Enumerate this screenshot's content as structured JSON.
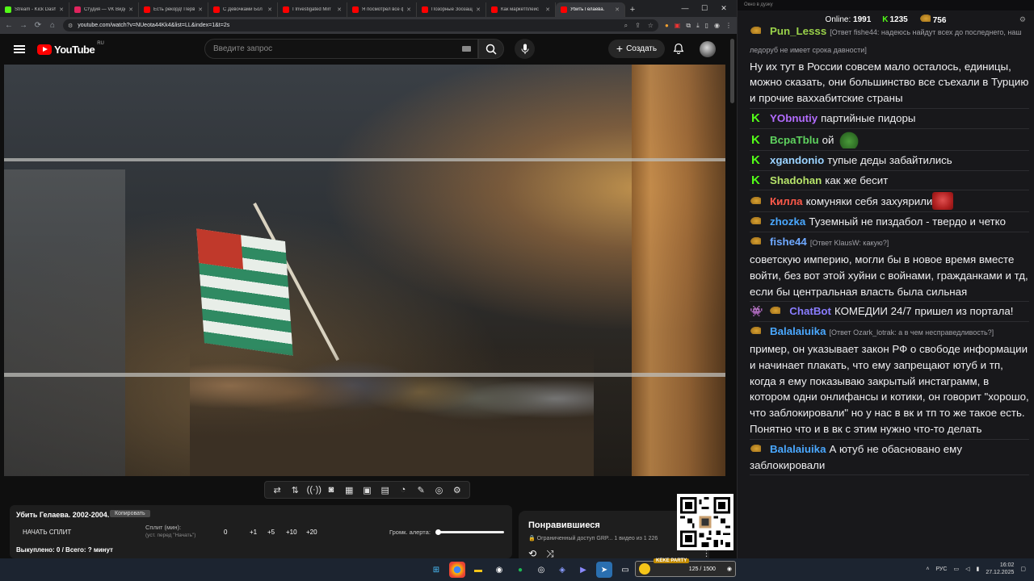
{
  "browser": {
    "tabs": [
      {
        "title": "Stream - Kick Dash",
        "color": "#53fc18",
        "active": false
      },
      {
        "title": "Студия — VK Видео",
        "color": "#e0245e",
        "active": false
      },
      {
        "title": "Есть рекорд! Перв",
        "color": "#ff0000",
        "active": false
      },
      {
        "title": "С Девочками Бол",
        "color": "#ff0000",
        "active": false
      },
      {
        "title": "I Investigated Mirr",
        "color": "#ff0000",
        "active": false
      },
      {
        "title": "Я посмотрел все ф",
        "color": "#ff0000",
        "active": false
      },
      {
        "title": "Позорные Зоозащ",
        "color": "#ff0000",
        "active": false
      },
      {
        "title": "Как маркетплейс",
        "color": "#ff0000",
        "active": false
      },
      {
        "title": "Убить Гелаева.",
        "color": "#ff0000",
        "active": true
      }
    ],
    "url": "youtube.com/watch?v=NUeota44Kk4&list=LL&index=1&t=2s"
  },
  "youtube": {
    "logo_text": "YouTube",
    "region": "RU",
    "search_placeholder": "Введите запрос",
    "create_label": "Создать",
    "plus": "+"
  },
  "controls": {
    "icons": [
      "loop-icon",
      "sort-icon",
      "broadcast-icon",
      "camera-eye-icon",
      "clapper-icon",
      "screen-icon",
      "subtitles-icon",
      "speed-icon",
      "edit-icon",
      "screenshot-icon",
      "settings-icon"
    ]
  },
  "split": {
    "title": "Убить Гелаева. 2002-2004.",
    "tag": "Копировать",
    "start_label": "НАЧАТЬ СПЛИТ",
    "split_label": "Сплит (мин):",
    "split_sub": "(уст. перед \"Начать\")",
    "values": [
      "0",
      "+1",
      "+5",
      "+10",
      "+20"
    ],
    "alert_label": "Громк. алерта:",
    "bought": "Выкуплено: 0 / Всего: ? минут"
  },
  "liked": {
    "heading": "Понравившиеся",
    "meta": "🔒 Ограниченный доступ GRP...   1 видео из 1 226"
  },
  "chat": {
    "title": "Окно в дуэку",
    "online_label": "Online:",
    "online": "1991",
    "kick_count": "1235",
    "coin_count": "756",
    "messages": [
      {
        "badge": "bb",
        "nick": "Pun_Lesss",
        "color": "#9ad24a",
        "reply": "[Ответ fishe44: надеюсь найдут всех до последнего, наш ледоруб не имеет срока давности]",
        "text": "Ну их тут в России совсем мало осталось, единицы, можно сказать, они большинство все съехали в Турцию и прочие ваххабитские страны"
      },
      {
        "badge": "k",
        "nick": "YObnutiy",
        "color": "#b36cff",
        "reply": "",
        "text": "партийные пидоры"
      },
      {
        "badge": "k",
        "nick": "BcpaTblu",
        "color": "#5fd35f",
        "reply": "",
        "text": "ой"
      },
      {
        "badge": "k",
        "nick": "xgandonio",
        "color": "#9bd3ff",
        "reply": "",
        "text": "тупые деды забайтились"
      },
      {
        "badge": "k",
        "nick": "Shadohan",
        "color": "#b6e36a",
        "reply": "",
        "text": "как же бесит"
      },
      {
        "badge": "bb",
        "nick": "Килла",
        "color": "#ff5a4a",
        "reply": "",
        "text": "комуняки себя захуярили"
      },
      {
        "badge": "bb",
        "nick": "zhozka",
        "color": "#4aa8ff",
        "reply": "",
        "text": "Туземный не пиздабол - твердо и четко"
      },
      {
        "badge": "bb",
        "nick": "fishe44",
        "color": "#6ea8ff",
        "reply": "[Ответ KlausW: какую?]",
        "text": "советскую империю, могли бы в новое время вместе войти, без вот этой хуйни с войнами, гражданками и тд, если бы центральная власть была сильная"
      },
      {
        "badge": "bot",
        "nick": "ChatBot",
        "color": "#8a7dff",
        "reply": "",
        "text": "КОМЕДИИ 24/7 пришел из портала!"
      },
      {
        "badge": "bb",
        "nick": "Balalaiuika",
        "color": "#4aa8ff",
        "reply": "[Ответ Ozark_lotrak: а в чем несправедливость?]",
        "text": "пример, он указывает закон РФ о свободе информации и начинает плакать, что ему запрещают ютуб и тп, когда я ему показываю закрытый инстаграмм, в котором одни онлифансы и котики, он говорит \"хорошо, что заблокировали\" но у нас в вк и тп то же такое есть. Понятно что и в вк с этим нужно что-то делать"
      },
      {
        "badge": "bb",
        "nick": "Balalaiuika",
        "color": "#4aa8ff",
        "reply": "",
        "text": "А ютуб не обасновано ему заблокировали"
      }
    ]
  },
  "widget": {
    "label": "KEKE PARTY",
    "progress": "125 / 1500"
  },
  "taskbar": {
    "lang": "РУС",
    "time": "16:02",
    "date": "27.12.2025"
  }
}
